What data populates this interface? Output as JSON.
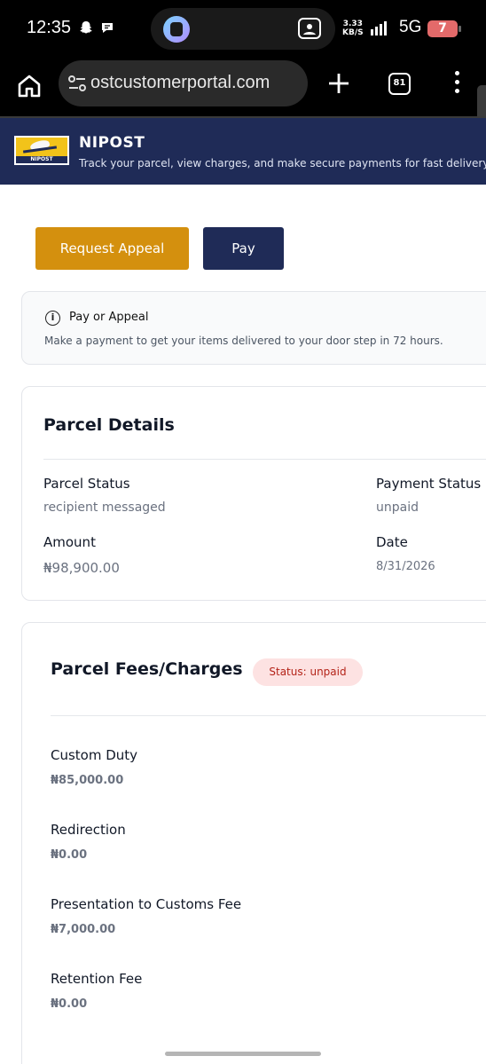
{
  "status_bar": {
    "time": "12:35",
    "speed_top": "3.33",
    "speed_unit": "KB/S",
    "network": "5G",
    "battery": "7",
    "icons": [
      "snapchat-icon",
      "chat-bubble-icon",
      "media-app-icon",
      "photo-scan-icon",
      "signal-icon"
    ]
  },
  "browser": {
    "url": "ostcustomerportal.com",
    "tab_count": "81",
    "icons": [
      "home-icon",
      "site-settings-icon",
      "plus-icon",
      "tabs-icon",
      "more-menu-icon"
    ]
  },
  "header": {
    "logo_text": "NIPOST",
    "brand": "NIPOST",
    "tagline": "Track your parcel, view charges, and make secure payments for fast delivery.",
    "bg_color": "#1f2b57"
  },
  "actions": {
    "appeal_label": "Request Appeal",
    "pay_label": "Pay",
    "appeal_color": "#d4900e",
    "pay_color": "#1f2b57"
  },
  "info": {
    "title": "Pay or Appeal",
    "text": "Make a payment to get your items delivered to your door step in 72 hours."
  },
  "parcel_details": {
    "title": "Parcel Details",
    "parcel_status_label": "Parcel Status",
    "parcel_status_value": "recipient messaged",
    "payment_status_label": "Payment Status",
    "payment_status_value": "unpaid",
    "amount_label": "Amount",
    "amount_value": "₦98,900.00",
    "date_label": "Date",
    "date_value": "8/31/2026"
  },
  "fees": {
    "title": "Parcel Fees/Charges",
    "status_badge": "Status: unpaid",
    "items": [
      {
        "label": "Custom Duty",
        "value": "₦85,000.00"
      },
      {
        "label": "Redirection",
        "value": "₦0.00"
      },
      {
        "label": "Presentation to Customs Fee",
        "value": "₦7,000.00"
      },
      {
        "label": "Retention Fee",
        "value": "₦0.00"
      }
    ]
  }
}
